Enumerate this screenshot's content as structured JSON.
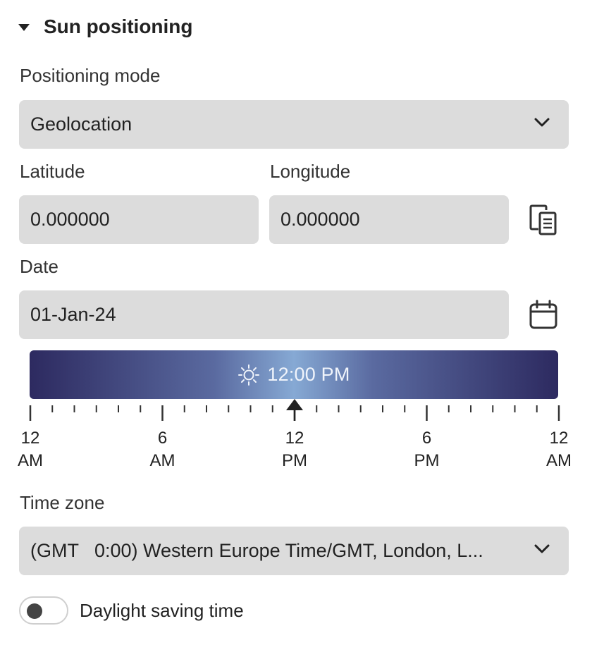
{
  "section": {
    "title": "Sun positioning"
  },
  "positioning": {
    "label": "Positioning mode",
    "value": "Geolocation"
  },
  "latitude": {
    "label": "Latitude",
    "value": "0.000000"
  },
  "longitude": {
    "label": "Longitude",
    "value": "0.000000"
  },
  "date": {
    "label": "Date",
    "value": "01-Jan-24"
  },
  "time_slider": {
    "time_label": "12:00 PM",
    "value_hours": 12,
    "range_hours": [
      0,
      24
    ],
    "tick_labels": [
      {
        "top": "12",
        "bottom": "AM",
        "hour": 0
      },
      {
        "top": "6",
        "bottom": "AM",
        "hour": 6
      },
      {
        "top": "12",
        "bottom": "PM",
        "hour": 12
      },
      {
        "top": "6",
        "bottom": "PM",
        "hour": 18
      },
      {
        "top": "12",
        "bottom": "AM",
        "hour": 24
      }
    ]
  },
  "timezone": {
    "label": "Time zone",
    "value": "(GMT   0:00) Western Europe Time/GMT, London, L..."
  },
  "dst": {
    "label": "Daylight saving time",
    "enabled": false
  },
  "icons": {
    "collapse": "caret-down-icon",
    "dropdown": "chevron-down-icon",
    "paste": "clipboard-paste-icon",
    "calendar": "calendar-icon",
    "sun": "sun-icon",
    "marker": "time-marker-icon"
  },
  "colors": {
    "field_bg": "#dcdcdc",
    "sun_bar_edge": "#2d2a60",
    "sun_bar_center": "#86a9d4"
  }
}
